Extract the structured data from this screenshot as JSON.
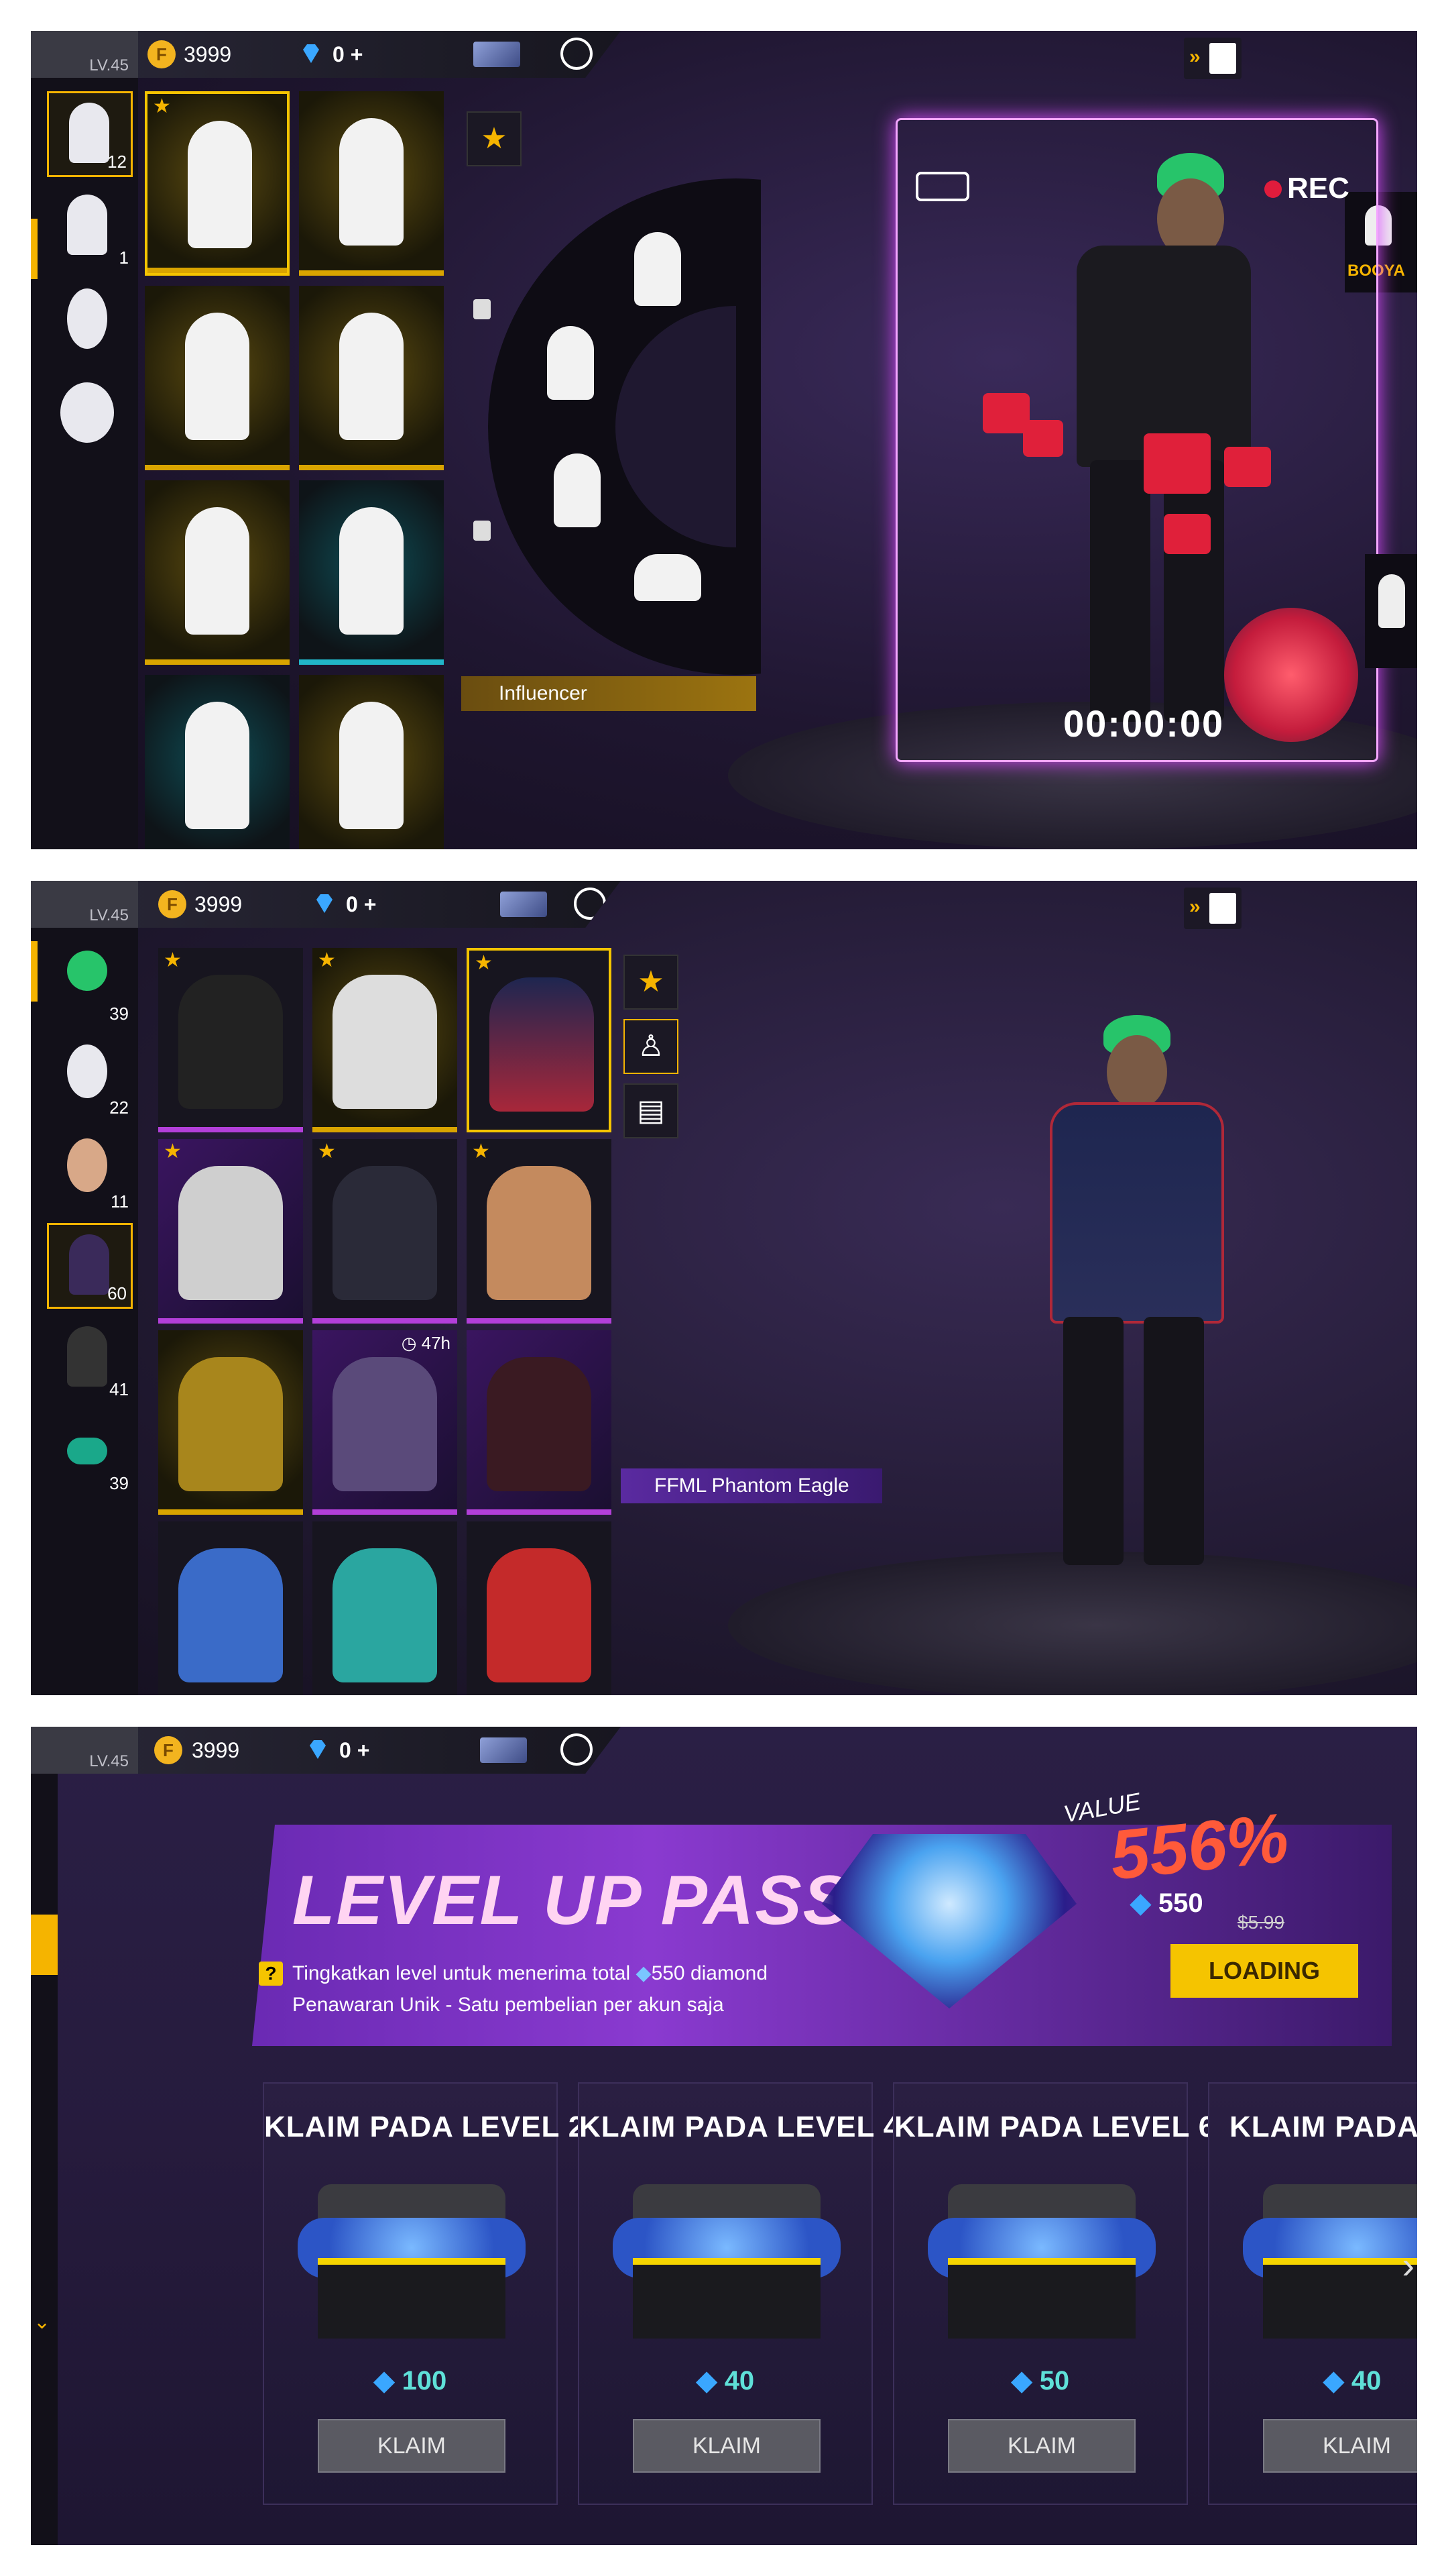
{
  "hud": {
    "level": "LV.45",
    "coin_symbol": "F",
    "coins": "3999",
    "diamonds": "0",
    "diamond_add": "+"
  },
  "panel1": {
    "categories": [
      {
        "name": "emote-single",
        "count": "12"
      },
      {
        "name": "emote-skate",
        "count": "1"
      },
      {
        "name": "emote-badge",
        "count": ""
      },
      {
        "name": "emote-wings",
        "count": ""
      }
    ],
    "influencer_label": "Influencer",
    "wheel_label_right": "BOOYA",
    "rec_label": "REC",
    "timer": "00:00:00"
  },
  "panel2": {
    "categories": [
      {
        "name": "hair",
        "count": "39"
      },
      {
        "name": "mask",
        "count": "22"
      },
      {
        "name": "face",
        "count": "11"
      },
      {
        "name": "top",
        "count": "60"
      },
      {
        "name": "bottom",
        "count": "41"
      },
      {
        "name": "shoes",
        "count": "39"
      }
    ],
    "timer_badge": "47h",
    "item_label": "FFML Phantom Eagle"
  },
  "panel3": {
    "banner_title": "LEVEL UP PASS",
    "banner_line1": "Tingkatkan level untuk menerima total",
    "banner_line1_diamond": "550 diamond",
    "banner_line2": "Penawaran Unik - Satu pembelian per akun saja",
    "value_label": "VALUE",
    "value_percent": "556%",
    "price_diamond": "550",
    "price_old": "$5.99",
    "load_button": "LOADING",
    "rewards": [
      {
        "title": "KLAIM PADA LEVEL 2",
        "amount": "100",
        "button": "KLAIM"
      },
      {
        "title": "KLAIM PADA LEVEL 4",
        "amount": "40",
        "button": "KLAIM"
      },
      {
        "title": "KLAIM PADA LEVEL 6",
        "amount": "50",
        "button": "KLAIM"
      },
      {
        "title": "KLAIM PADA L",
        "amount": "40",
        "button": "KLAIM"
      }
    ]
  },
  "colors": {
    "accent": "#f5b400",
    "purple": "#b33fd9",
    "heart": "#e0203a"
  }
}
